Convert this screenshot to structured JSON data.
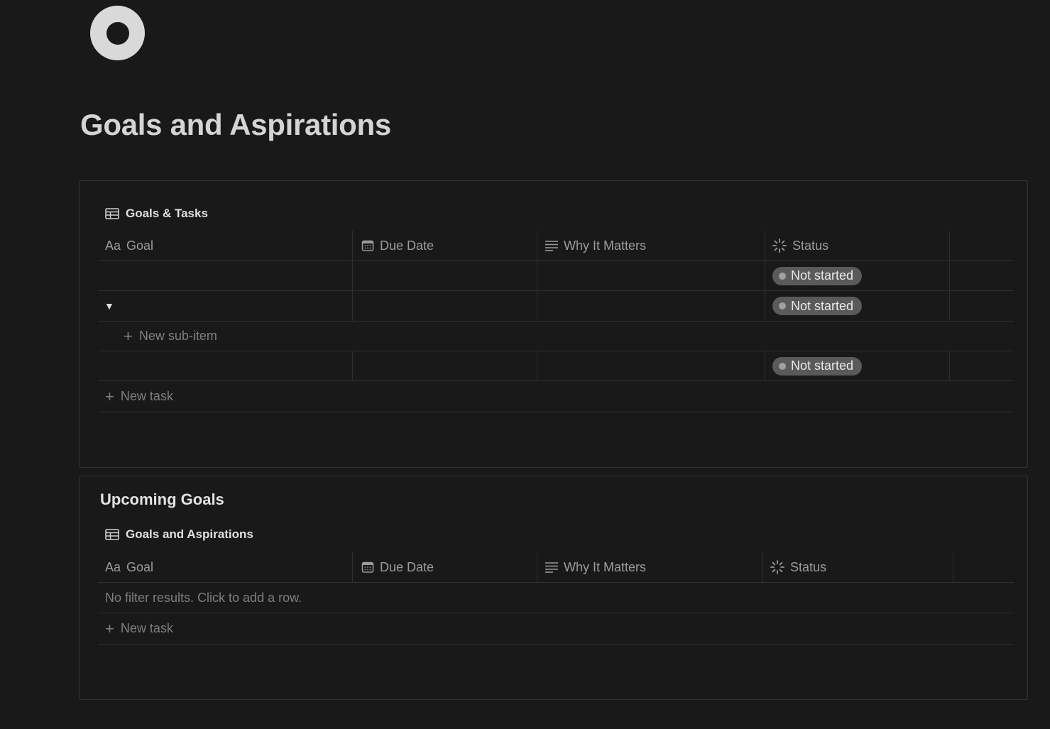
{
  "page": {
    "title": "Goals and Aspirations",
    "icon": "circle-ring-icon"
  },
  "database1": {
    "title": "Goals & Tasks",
    "columns": [
      "Goal",
      "Due Date",
      "Why It Matters",
      "Status"
    ],
    "goal_prefix": "Aa",
    "rows": [
      {
        "goal": "",
        "due_date": "",
        "why": "",
        "status": "Not started"
      },
      {
        "goal": "",
        "due_date": "",
        "why": "",
        "status": "Not started",
        "expanded": true
      },
      {
        "goal": "",
        "due_date": "",
        "why": "",
        "status": "Not started"
      }
    ],
    "new_sub_item_label": "New sub-item",
    "new_task_label": "New task"
  },
  "section2": {
    "heading": "Upcoming Goals"
  },
  "database2": {
    "title": "Goals and Aspirations",
    "columns": [
      "Goal",
      "Due Date",
      "Why It Matters",
      "Status"
    ],
    "goal_prefix": "Aa",
    "empty_message": "No filter results. Click to add a row.",
    "new_task_label": "New task"
  },
  "colors": {
    "background": "#191919",
    "status_pill": "#5a5a5a",
    "border": "#2f2f2f"
  }
}
